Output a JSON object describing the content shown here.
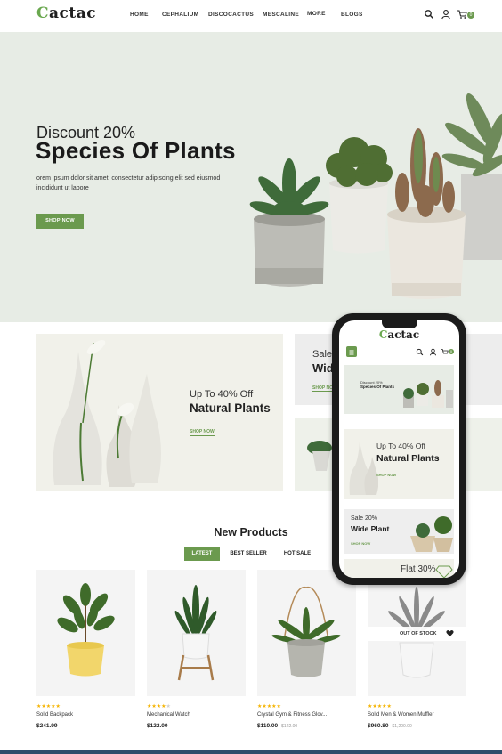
{
  "header": {
    "logo_first": "C",
    "logo_rest": "actac",
    "nav": [
      "HOME",
      "CEPHALIUM",
      "DISCOCACTUS",
      "MESCALINE",
      "MORE",
      "BLOGS"
    ],
    "cart_count": "0",
    "icons": [
      "search-icon",
      "user-icon",
      "cart-icon"
    ]
  },
  "hero": {
    "subtitle": "Discount 20%",
    "title": "Species Of Plants",
    "text": "orem ipsum dolor sit amet, consectetur adipiscing elit sed eiusmod incididunt ut labore",
    "button": "SHOP NOW"
  },
  "banners": [
    {
      "subtitle": "Up To 40% Off",
      "title": "Natural Plants",
      "link": "SHOP NOW"
    },
    {
      "subtitle": "Sale",
      "title": "Wid",
      "link": "SHOP NOW"
    }
  ],
  "products_section": {
    "title": "New Products",
    "tabs": [
      "LATEST",
      "BEST SELLER",
      "HOT SALE"
    ],
    "active_tab": "LATEST",
    "items": [
      {
        "name": "Solid Backpack",
        "price": "$241.99",
        "old_price": "",
        "rating": 5
      },
      {
        "name": "Mechanical Watch",
        "price": "$122.00",
        "old_price": "",
        "rating": 4
      },
      {
        "name": "Crystal Gym & Fitness Glov...",
        "price": "$110.00",
        "old_price": "$122.00",
        "rating": 5
      },
      {
        "name": "Solid Men & Women Muffler",
        "price": "$960.80",
        "old_price": "$1,200.00",
        "rating": 5
      }
    ],
    "out_of_stock_label": "OUT OF STOCK"
  },
  "phone": {
    "logo_first": "C",
    "logo_rest": "actac",
    "cart_count": "0",
    "hero_subtitle": "Discount 20%",
    "hero_title": "Species Of Plants",
    "banner1_subtitle": "Up To 40% Off",
    "banner1_title": "Natural Plants",
    "banner1_link": "SHOP NOW",
    "banner2_subtitle": "Sale 20%",
    "banner2_title": "Wide Plant",
    "banner2_link": "SHOP NOW",
    "banner3_title": "Flat 30%"
  },
  "colors": {
    "accent": "#6b9a4e",
    "hero_bg": "#e7ece5",
    "star": "#f5b301",
    "footer_line": "#2f4d6b"
  }
}
